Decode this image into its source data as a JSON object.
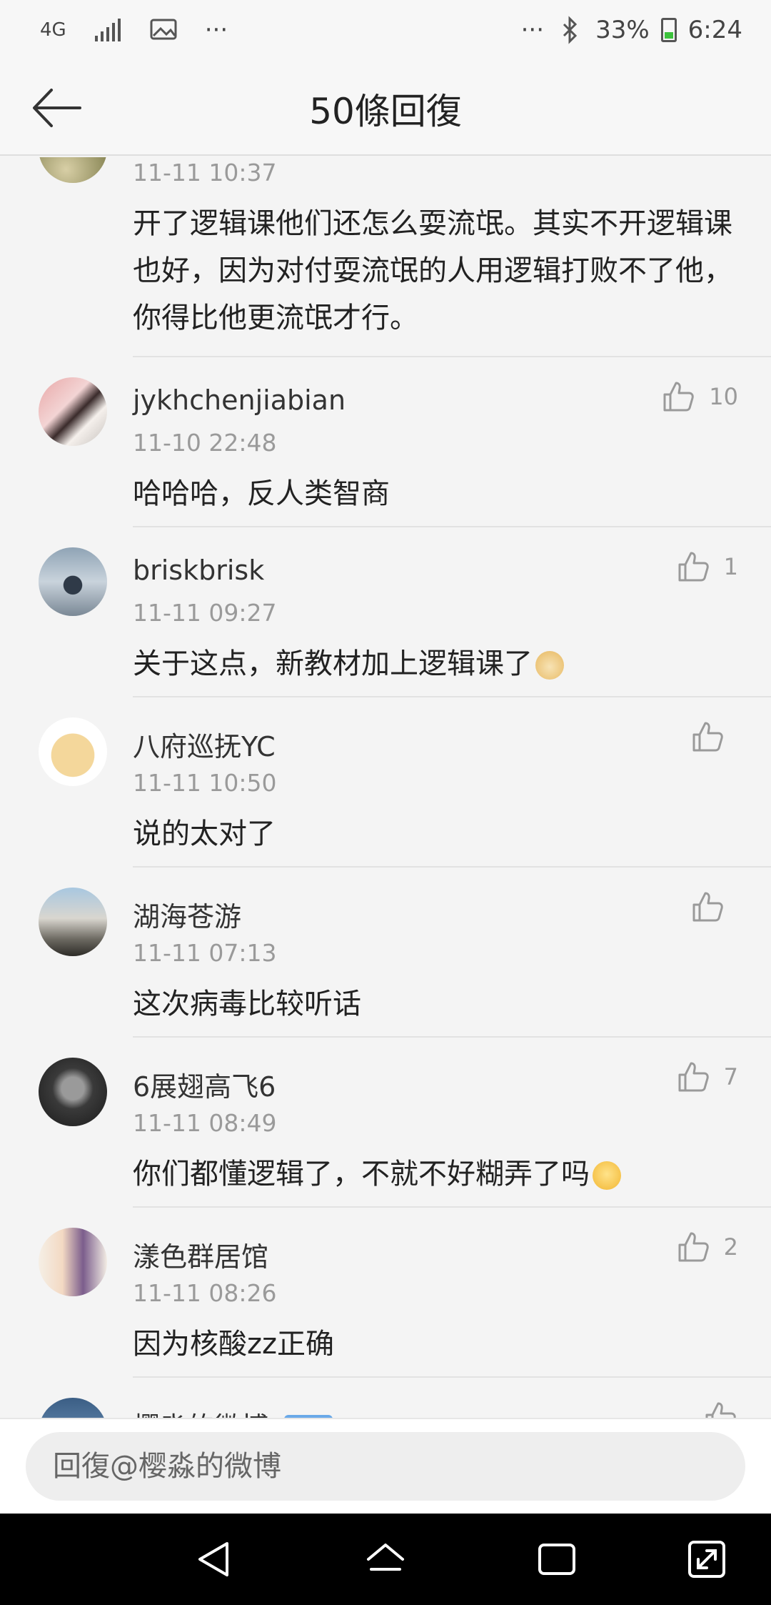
{
  "status_bar": {
    "network": "4G",
    "more": "···",
    "more_right": "···",
    "battery": "33%",
    "time": "6:24"
  },
  "header": {
    "title": "50條回復"
  },
  "comments": [
    {
      "time": "11-11 10:37",
      "text": "开了逻辑课他们还怎么耍流氓。其实不开逻辑课也好，因为对付耍流氓的人用逻辑打败不了他，你得比他更流氓才行。"
    },
    {
      "user": "jykhchenjiabian",
      "time": "11-10 22:48",
      "text": "哈哈哈，反人类智商",
      "likes": "10"
    },
    {
      "user": "briskbrisk",
      "time": "11-11 09:27",
      "text": "关于这点，新教材加上逻辑课了",
      "likes": "1"
    },
    {
      "user": "八府巡抚YC",
      "time": "11-11 10:50",
      "text": "说的太对了",
      "likes": ""
    },
    {
      "user": "湖海苍游",
      "time": "11-11 07:13",
      "text": "这次病毒比较听话",
      "likes": ""
    },
    {
      "user": "6展翅高飞6",
      "time": "11-11 08:49",
      "text": "你们都懂逻辑了，不就不好糊弄了吗",
      "likes": "7"
    },
    {
      "user": "漾色群居馆",
      "time": "11-11 08:26",
      "text": "因为核酸zz正确",
      "likes": "2"
    },
    {
      "user": "樱淼的微博",
      "badge": "铁粉"
    }
  ],
  "reply_bar": {
    "placeholder": "回復@樱淼的微博"
  },
  "colors": {
    "background": "#f4f4f4",
    "timestamp": "#9a9a9a",
    "badge": "#6aa9e8",
    "nav_bar": "#000000"
  }
}
